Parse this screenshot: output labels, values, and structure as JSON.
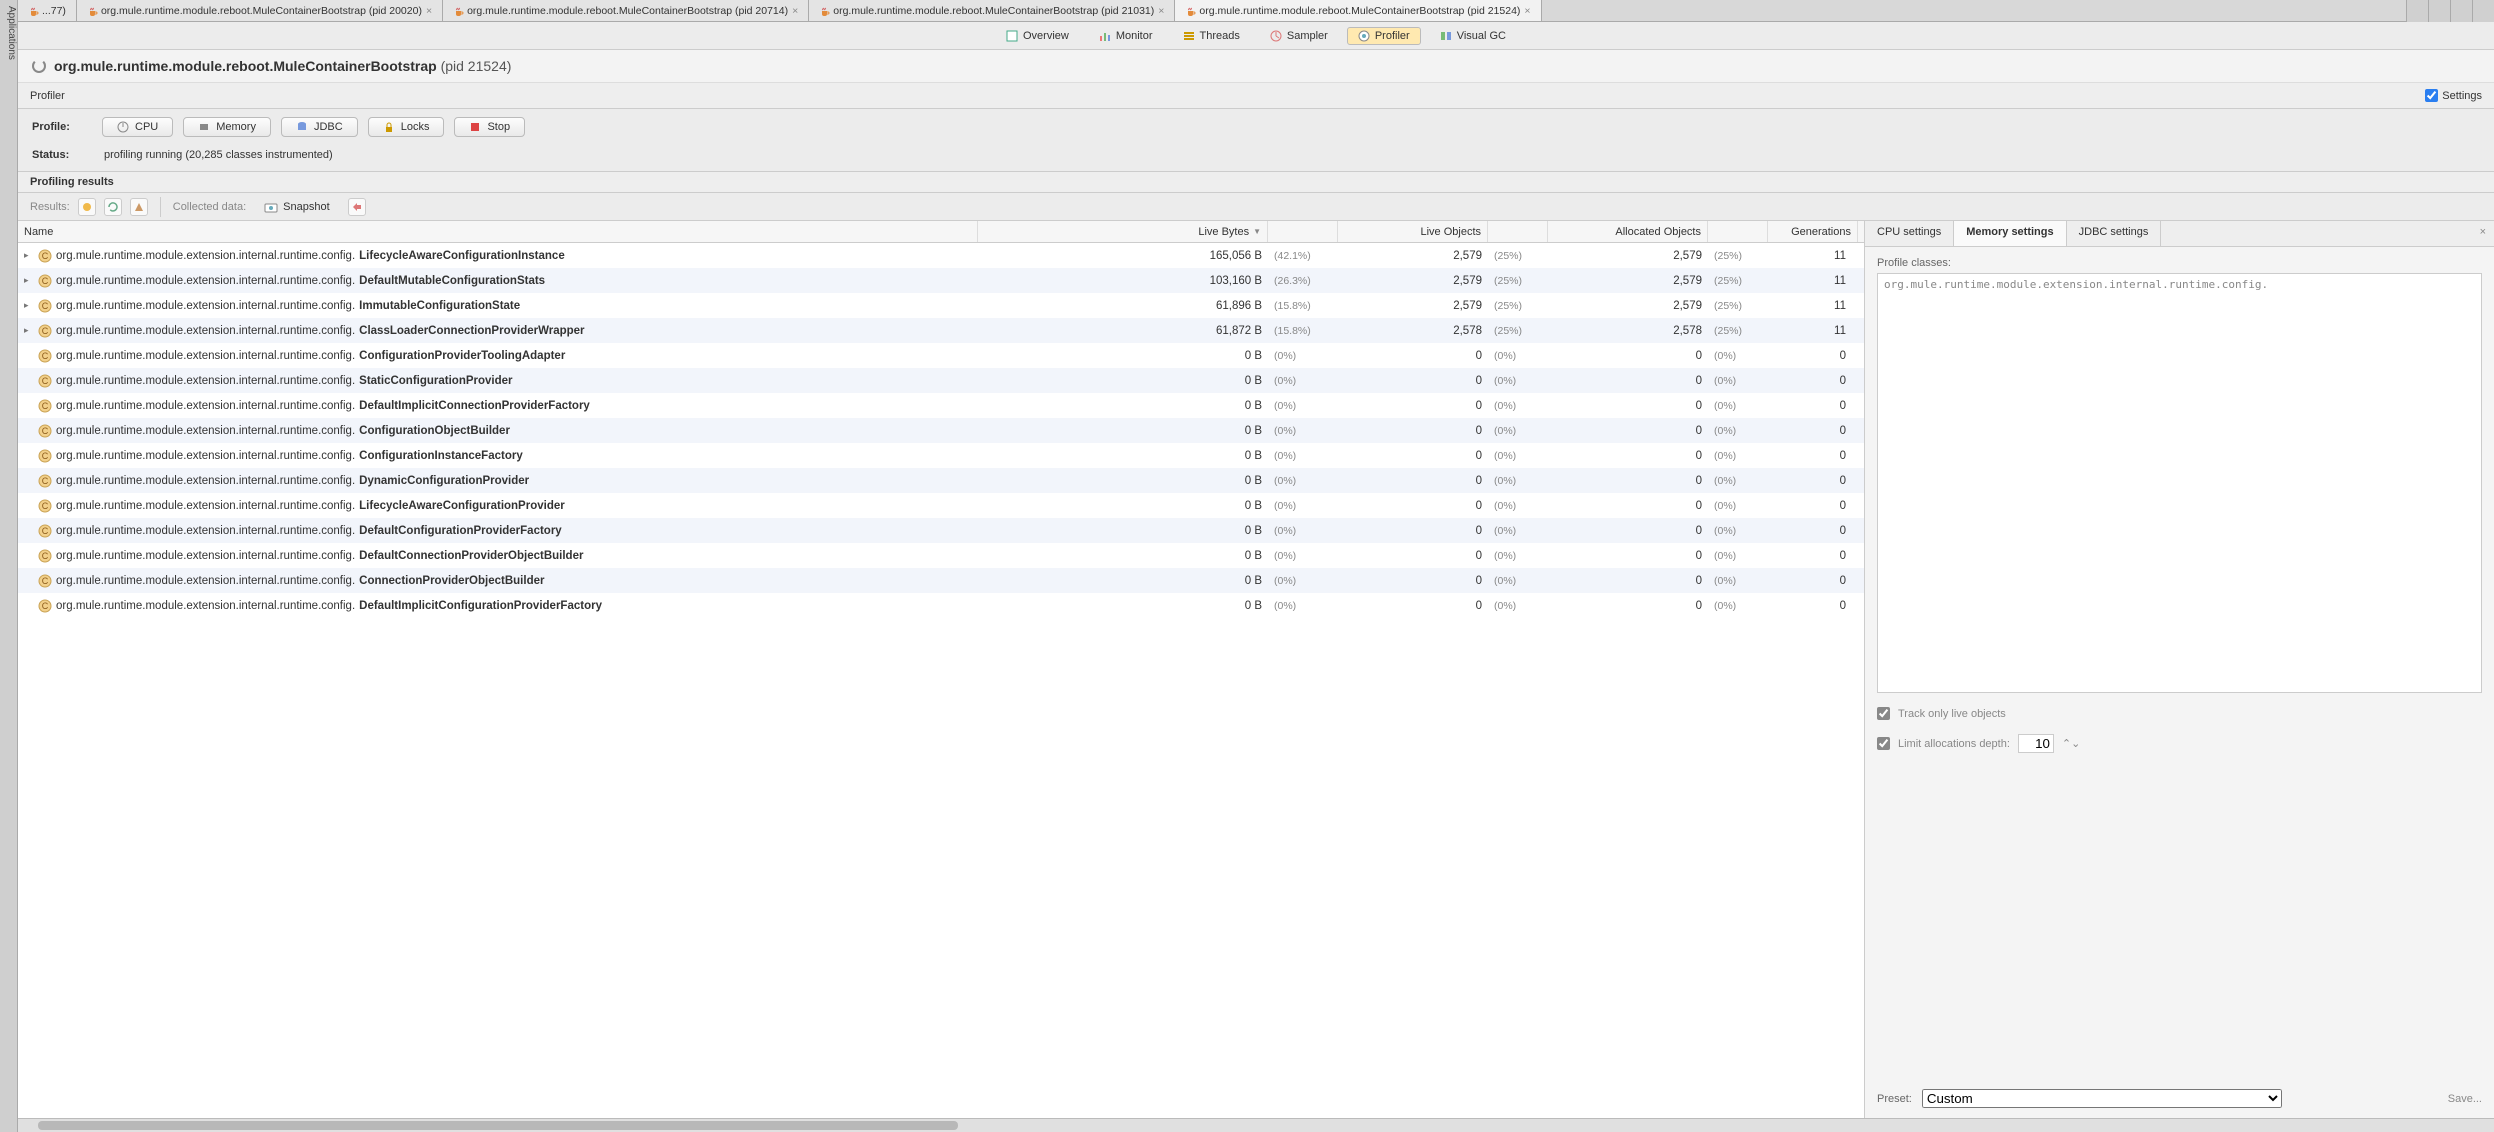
{
  "app_rail_label": "Applications",
  "window_tabs": [
    {
      "label": "...77)",
      "closable": false
    },
    {
      "label": "org.mule.runtime.module.reboot.MuleContainerBootstrap (pid 20020)",
      "closable": true
    },
    {
      "label": "org.mule.runtime.module.reboot.MuleContainerBootstrap (pid 20714)",
      "closable": true
    },
    {
      "label": "org.mule.runtime.module.reboot.MuleContainerBootstrap (pid 21031)",
      "closable": true
    },
    {
      "label": "org.mule.runtime.module.reboot.MuleContainerBootstrap (pid 21524)",
      "closable": true,
      "active": true
    }
  ],
  "view_buttons": [
    {
      "name": "overview",
      "label": "Overview"
    },
    {
      "name": "monitor",
      "label": "Monitor"
    },
    {
      "name": "threads",
      "label": "Threads"
    },
    {
      "name": "sampler",
      "label": "Sampler"
    },
    {
      "name": "profiler",
      "label": "Profiler",
      "selected": true
    },
    {
      "name": "visualgc",
      "label": "Visual GC"
    }
  ],
  "title": {
    "main": "org.mule.runtime.module.reboot.MuleContainerBootstrap",
    "pid": " (pid 21524)"
  },
  "profiler_header": "Profiler",
  "settings_label": "Settings",
  "profile": {
    "label": "Profile:",
    "buttons": [
      {
        "name": "cpu",
        "label": "CPU"
      },
      {
        "name": "memory",
        "label": "Memory"
      },
      {
        "name": "jdbc",
        "label": "JDBC"
      },
      {
        "name": "locks",
        "label": "Locks"
      },
      {
        "name": "stop",
        "label": "Stop"
      }
    ]
  },
  "status": {
    "label": "Status:",
    "text": "profiling running (20,285 classes instrumented)"
  },
  "results_header": "Profiling results",
  "results_toolbar": {
    "results_label": "Results:",
    "collected_label": "Collected data:",
    "snapshot_label": "Snapshot"
  },
  "columns": {
    "name": "Name",
    "live_bytes": "Live Bytes",
    "live_objects": "Live Objects",
    "alloc_objects": "Allocated Objects",
    "generations": "Generations"
  },
  "package_prefix": "org.mule.runtime.module.extension.internal.runtime.config.",
  "max_bytes": 165056,
  "rows": [
    {
      "cls": "LifecycleAwareConfigurationInstance",
      "bytes": "165,056 B",
      "bval": 165056,
      "bpct": "(42.1%)",
      "lobj": "2,579",
      "lpct": "(25%)",
      "aobj": "2,579",
      "apct": "(25%)",
      "gen": "11",
      "exp": true
    },
    {
      "cls": "DefaultMutableConfigurationStats",
      "bytes": "103,160 B",
      "bval": 103160,
      "bpct": "(26.3%)",
      "lobj": "2,579",
      "lpct": "(25%)",
      "aobj": "2,579",
      "apct": "(25%)",
      "gen": "11",
      "exp": true
    },
    {
      "cls": "ImmutableConfigurationState",
      "bytes": "61,896 B",
      "bval": 61896,
      "bpct": "(15.8%)",
      "lobj": "2,579",
      "lpct": "(25%)",
      "aobj": "2,579",
      "apct": "(25%)",
      "gen": "11",
      "exp": true
    },
    {
      "cls": "ClassLoaderConnectionProviderWrapper",
      "bytes": "61,872 B",
      "bval": 61872,
      "bpct": "(15.8%)",
      "lobj": "2,578",
      "lpct": "(25%)",
      "aobj": "2,578",
      "apct": "(25%)",
      "gen": "11",
      "exp": true
    },
    {
      "cls": "ConfigurationProviderToolingAdapter",
      "bytes": "0 B",
      "bval": 0,
      "bpct": "(0%)",
      "lobj": "0",
      "lpct": "(0%)",
      "aobj": "0",
      "apct": "(0%)",
      "gen": "0"
    },
    {
      "cls": "StaticConfigurationProvider",
      "bytes": "0 B",
      "bval": 0,
      "bpct": "(0%)",
      "lobj": "0",
      "lpct": "(0%)",
      "aobj": "0",
      "apct": "(0%)",
      "gen": "0"
    },
    {
      "cls": "DefaultImplicitConnectionProviderFactory",
      "bytes": "0 B",
      "bval": 0,
      "bpct": "(0%)",
      "lobj": "0",
      "lpct": "(0%)",
      "aobj": "0",
      "apct": "(0%)",
      "gen": "0"
    },
    {
      "cls": "ConfigurationObjectBuilder",
      "bytes": "0 B",
      "bval": 0,
      "bpct": "(0%)",
      "lobj": "0",
      "lpct": "(0%)",
      "aobj": "0",
      "apct": "(0%)",
      "gen": "0"
    },
    {
      "cls": "ConfigurationInstanceFactory",
      "bytes": "0 B",
      "bval": 0,
      "bpct": "(0%)",
      "lobj": "0",
      "lpct": "(0%)",
      "aobj": "0",
      "apct": "(0%)",
      "gen": "0"
    },
    {
      "cls": "DynamicConfigurationProvider",
      "bytes": "0 B",
      "bval": 0,
      "bpct": "(0%)",
      "lobj": "0",
      "lpct": "(0%)",
      "aobj": "0",
      "apct": "(0%)",
      "gen": "0"
    },
    {
      "cls": "LifecycleAwareConfigurationProvider",
      "bytes": "0 B",
      "bval": 0,
      "bpct": "(0%)",
      "lobj": "0",
      "lpct": "(0%)",
      "aobj": "0",
      "apct": "(0%)",
      "gen": "0"
    },
    {
      "cls": "DefaultConfigurationProviderFactory",
      "bytes": "0 B",
      "bval": 0,
      "bpct": "(0%)",
      "lobj": "0",
      "lpct": "(0%)",
      "aobj": "0",
      "apct": "(0%)",
      "gen": "0"
    },
    {
      "cls": "DefaultConnectionProviderObjectBuilder",
      "bytes": "0 B",
      "bval": 0,
      "bpct": "(0%)",
      "lobj": "0",
      "lpct": "(0%)",
      "aobj": "0",
      "apct": "(0%)",
      "gen": "0"
    },
    {
      "cls": "ConnectionProviderObjectBuilder",
      "bytes": "0 B",
      "bval": 0,
      "bpct": "(0%)",
      "lobj": "0",
      "lpct": "(0%)",
      "aobj": "0",
      "apct": "(0%)",
      "gen": "0"
    },
    {
      "cls": "DefaultImplicitConfigurationProviderFactory",
      "bytes": "0 B",
      "bval": 0,
      "bpct": "(0%)",
      "lobj": "0",
      "lpct": "(0%)",
      "aobj": "0",
      "apct": "(0%)",
      "gen": "0"
    }
  ],
  "side": {
    "tabs": [
      {
        "label": "CPU settings"
      },
      {
        "label": "Memory settings",
        "active": true
      },
      {
        "label": "JDBC settings"
      }
    ],
    "profile_classes_label": "Profile classes:",
    "profile_classes_value": "org.mule.runtime.module.extension.internal.runtime.config.",
    "track_live": "Track only live objects",
    "limit_depth": "Limit allocations depth:",
    "depth_value": "10",
    "preset_label": "Preset:",
    "preset_value": "Custom",
    "save_label": "Save..."
  }
}
